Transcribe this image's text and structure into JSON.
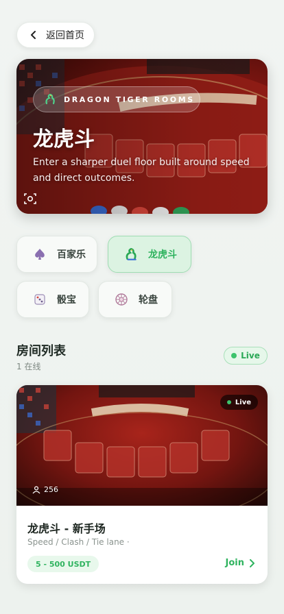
{
  "header": {
    "back_label": "返回首页"
  },
  "hero": {
    "tag": "DRAGON TIGER ROOMS",
    "title": "龙虎斗",
    "description": "Enter a sharper duel floor built around speed and direct outcomes."
  },
  "games": [
    {
      "label": "百家乐",
      "icon": "spade-icon",
      "active": false
    },
    {
      "label": "龙虎斗",
      "icon": "dragon-icon",
      "active": true
    },
    {
      "label": "骰宝",
      "icon": "dice-icon",
      "active": false
    },
    {
      "label": "轮盘",
      "icon": "roulette-icon",
      "active": false
    }
  ],
  "section": {
    "title": "房间列表",
    "subtitle": "1 在线",
    "live_badge": "Live"
  },
  "room": {
    "status": "Live",
    "viewers": "256",
    "name": "龙虎斗 - 新手场",
    "tags": "Speed / Clash / Tie lane ·",
    "limit": "5 - 500 USDT",
    "join_label": "Join"
  },
  "colors": {
    "accent": "#2fb35f",
    "felt": "#8e1c15"
  }
}
